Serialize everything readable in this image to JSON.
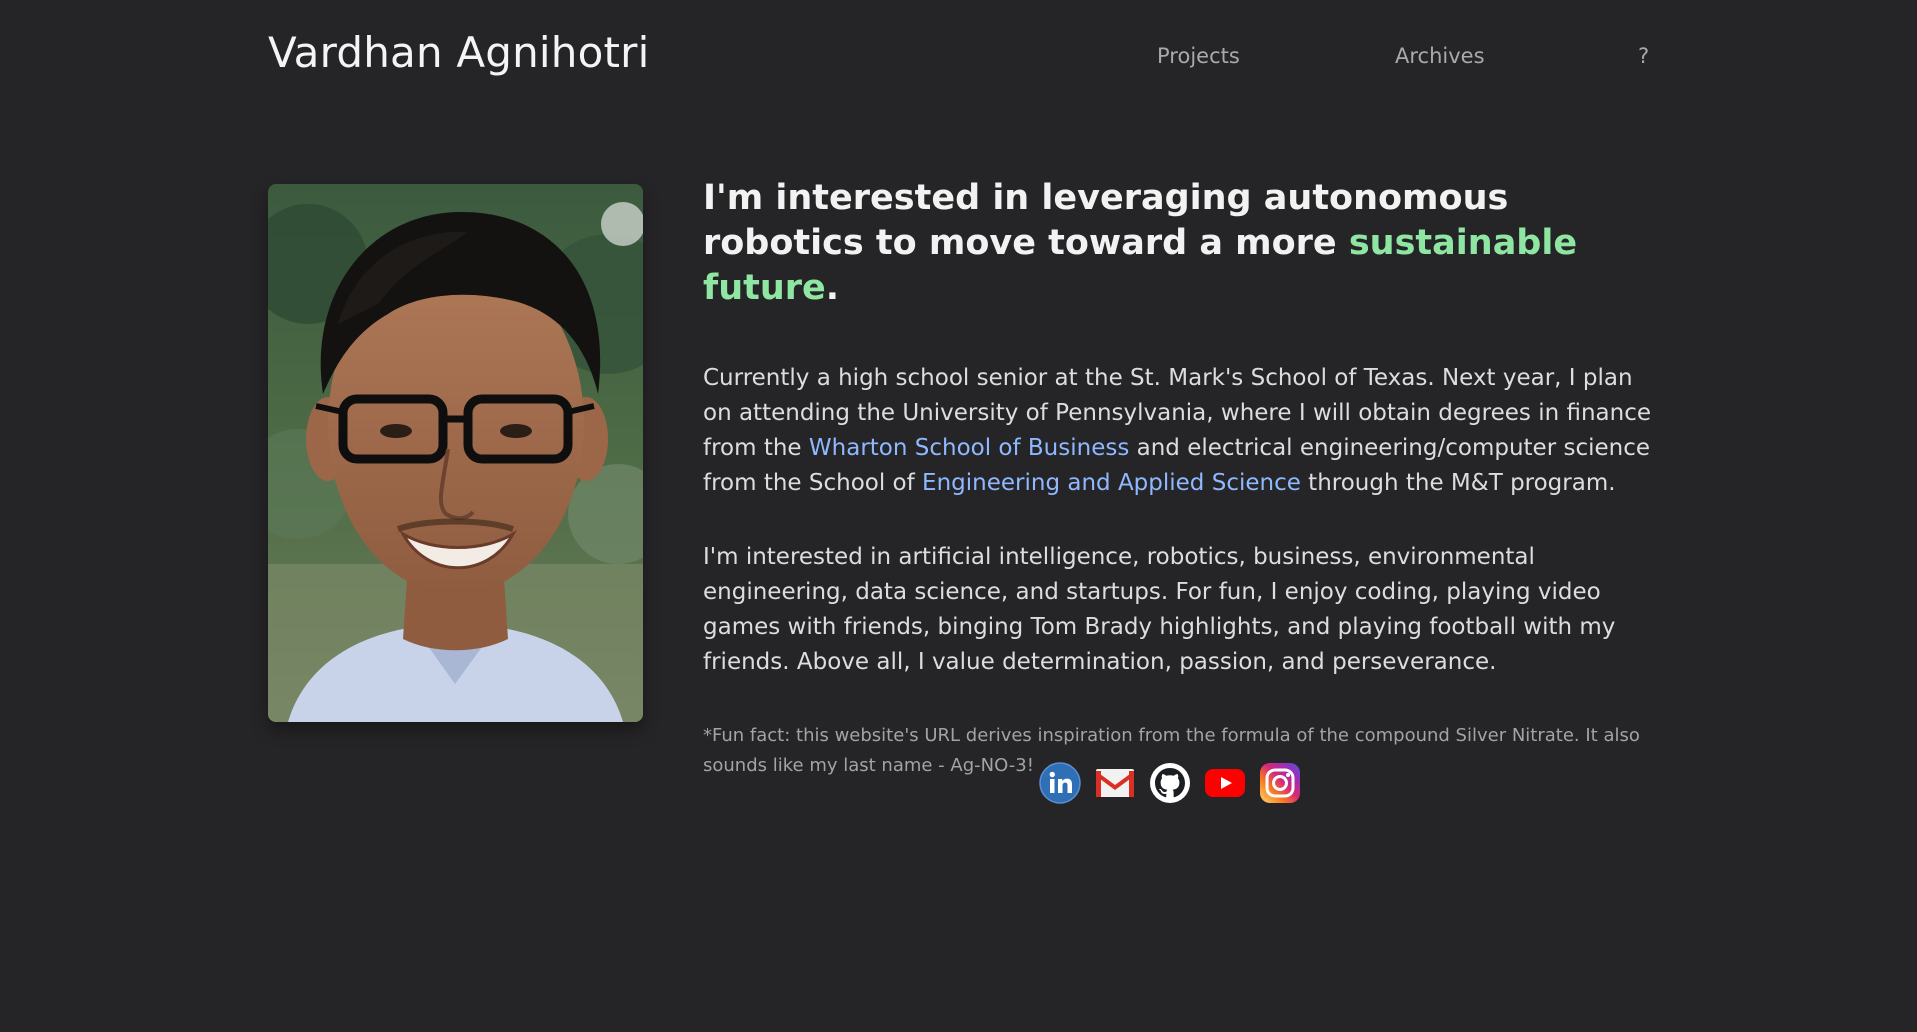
{
  "site": {
    "title": "Vardhan Agnihotri"
  },
  "nav": {
    "projects": "Projects",
    "archives": "Archives",
    "help": "?"
  },
  "intro": {
    "headline_part1": "I'm interested in leveraging autonomous robotics to move toward a more ",
    "headline_accent": "sustainable future",
    "headline_end": ".",
    "accent_color": "#8fe6a2"
  },
  "bio": {
    "p1_a": "Currently a high school senior at the St. Mark's School of Texas. Next year, I plan on attending the University of Pennsylvania, where I will obtain degrees in finance from the ",
    "p1_link1": "Wharton School of Business",
    "p1_b": " and electrical engineering/computer science from the School of ",
    "p1_link2": "Engineering and Applied Science",
    "p1_c": " through the M&T program.",
    "p2": "I'm interested in artificial intelligence, robotics, business, environmental engineering, data science, and startups. For fun, I enjoy coding, playing video games with friends, binging Tom Brady highlights, and playing football with my friends. Above all, I value determination, passion, and perseverance.",
    "funfact": "*Fun fact: this website's URL derives inspiration from the formula of the compound Silver Nitrate. It also sounds like my last name - Ag-NO-3!",
    "link_color": "#8fb8ff"
  },
  "socials": [
    {
      "icon": "linkedin-icon"
    },
    {
      "icon": "gmail-icon"
    },
    {
      "icon": "github-icon"
    },
    {
      "icon": "youtube-icon"
    },
    {
      "icon": "instagram-icon"
    }
  ],
  "colors": {
    "background": "#252527",
    "text": "#dddddf",
    "muted": "#a3a3a6"
  }
}
